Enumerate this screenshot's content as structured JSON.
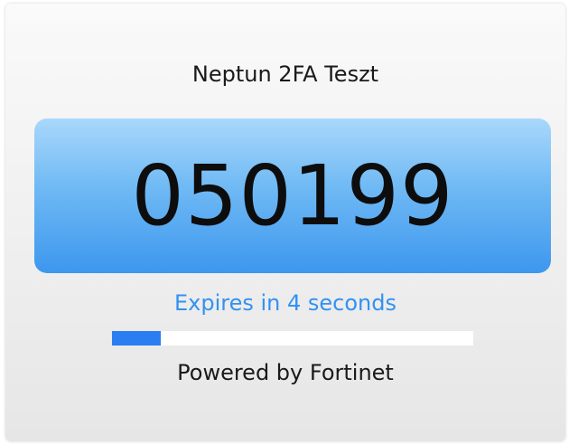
{
  "app": {
    "title": "Neptun 2FA Teszt"
  },
  "token": {
    "code": "050199",
    "expires_text": "Expires in 4 seconds",
    "progress_fraction": 0.135
  },
  "footer": {
    "powered_by": "Powered by Fortinet"
  },
  "colors": {
    "accent": "#3391f2",
    "progress_fill": "#2a7ef2",
    "code_box_top": "#a9d8fb",
    "code_box_bottom": "#3d97ee"
  }
}
